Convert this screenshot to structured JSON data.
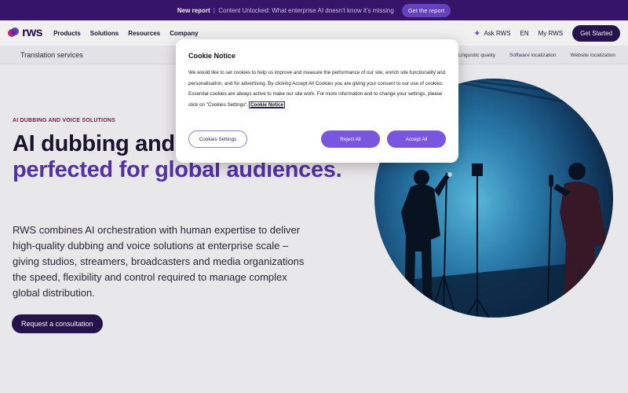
{
  "announcement": {
    "new_label": "New report",
    "separator": "|",
    "text": "Content Unlocked: What enterprise AI doesn't know it's missing",
    "button": "Get the report"
  },
  "nav": {
    "logo": "rws",
    "links": [
      "Products",
      "Solutions",
      "Resources",
      "Company"
    ],
    "ask": "Ask RWS",
    "language": "EN",
    "my_rws": "My RWS",
    "get_started": "Get Started"
  },
  "subnav": {
    "title": "Translation services",
    "items": [
      "Linguistic quality",
      "Software localization",
      "Website localization"
    ]
  },
  "hero": {
    "eyebrow": "AI DUBBING AND VOICE SOLUTIONS",
    "headline_plain": "AI dubbing and voice services, ",
    "headline_accent": "perfected for global audiences.",
    "body": "RWS combines AI orchestration with human expertise to deliver high-quality dubbing and voice solutions at enterprise scale – giving studios, streamers, broadcasters and media organizations the speed, flexibility and control required to manage complex global distribution.",
    "cta": "Request a consultation"
  },
  "cookie": {
    "title": "Cookie Notice",
    "text": "We would like to set cookies to help us improve and measure the performance of our site, enrich site functionality and personalisation, and for advertising. By clicking Accept All Cookies you are giving your consent to our use of cookies. Essential cookies are always active to make our site work. For more information and to change your settings, please click on \"Cookies Settings\".",
    "link": "Cookie Notice",
    "settings": "Cookies Settings",
    "reject": "Reject All",
    "accept": "Accept All"
  },
  "colors": {
    "brand_dark": "#2a1550",
    "announcement_bg": "#3a1670",
    "accent_purple": "#5a34b0",
    "button_purple": "#7a55e0",
    "eyebrow": "#7a1f48"
  },
  "icons": {
    "ask": "sparkle-icon"
  }
}
